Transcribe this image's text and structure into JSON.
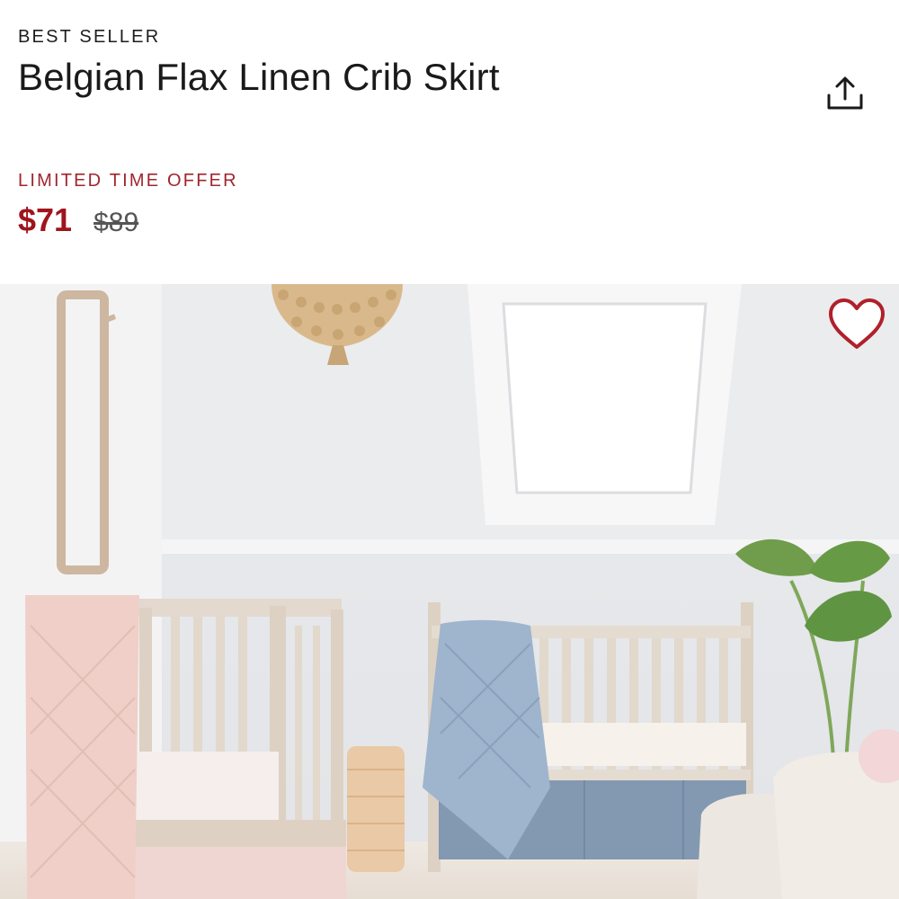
{
  "product": {
    "badge": "BEST SELLER",
    "title": "Belgian Flax Linen Crib Skirt",
    "offer_label": "LIMITED TIME OFFER",
    "sale_price": "$71",
    "original_price": "$89"
  },
  "icons": {
    "share": "share-icon",
    "favorite": "heart-icon"
  },
  "colors": {
    "sale": "#a0141c",
    "offer": "#a0262e",
    "heart": "#b0202a"
  }
}
